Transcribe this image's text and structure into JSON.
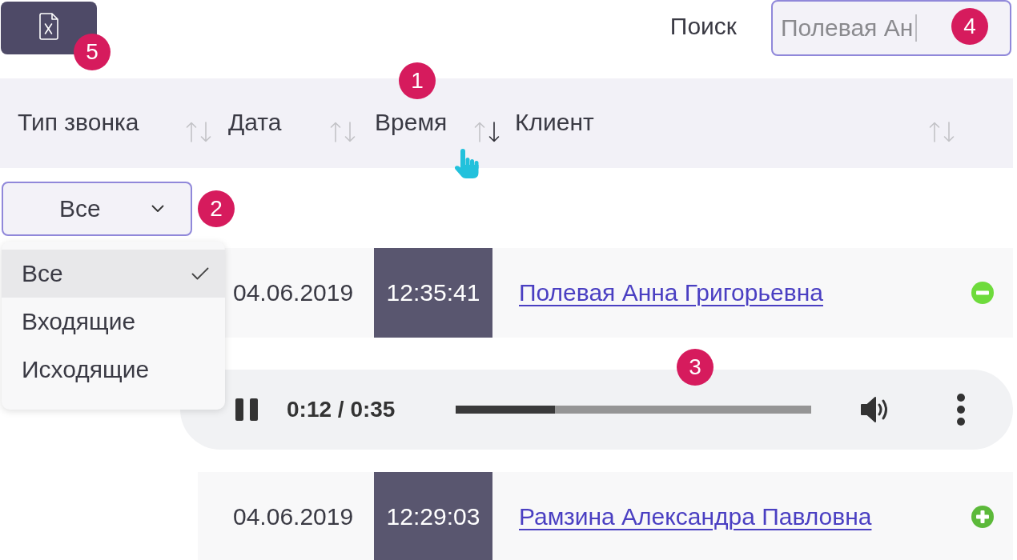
{
  "toolbar": {
    "export_button": {
      "badge": "5"
    },
    "search": {
      "label": "Поиск",
      "value": "Полевая Ан",
      "focused": true,
      "badge": "4"
    }
  },
  "table": {
    "columns": [
      {
        "label": "Тип звонка",
        "sorted_desc": false,
        "hovered": false
      },
      {
        "label": "Дата",
        "sorted_desc": false,
        "hovered": false
      },
      {
        "label": "Время",
        "sorted_desc": true,
        "hovered": true,
        "badge": "1"
      },
      {
        "label": "Клиент",
        "sorted_desc": false,
        "hovered": false
      }
    ],
    "filter": {
      "value": "Все",
      "expanded": true,
      "badge": "2",
      "options": [
        {
          "label": "Все",
          "selected": true
        },
        {
          "label": "Входящие",
          "selected": false
        },
        {
          "label": "Исходящие",
          "selected": false
        }
      ]
    },
    "rows": [
      {
        "date": "04.06.2019",
        "time": "12:35:41",
        "client": "Полевая Анна Григорьевна",
        "expanded": true,
        "player": {
          "playing": true,
          "time": "0:12 / 0:35",
          "level": 0.28,
          "badge": "3"
        }
      },
      {
        "date": "04.06.2019",
        "time": "12:29:03",
        "client": "Рамзина Александра Павловна",
        "expanded": false
      }
    ]
  }
}
